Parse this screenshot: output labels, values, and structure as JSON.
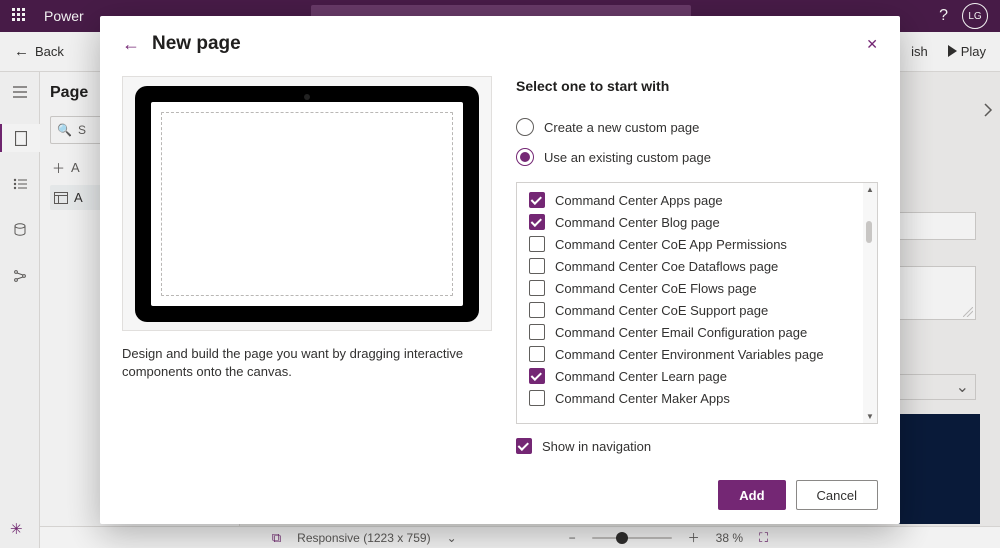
{
  "app": {
    "name": "Power",
    "user_initials": "LG"
  },
  "cmdbar": {
    "back": "Back",
    "publish_tail": "ish",
    "play": "Play"
  },
  "pages_panel": {
    "heading": "Page",
    "search_stub": "S",
    "add_stub": "A",
    "tree_stub": "A"
  },
  "statusbar": {
    "responsive": "Responsive (1223 x 759)",
    "zoom": "38 %"
  },
  "modal": {
    "title": "New page",
    "description": "Design and build the page you want by dragging interactive components onto the canvas.",
    "select_heading": "Select one to start with",
    "radios": {
      "create": {
        "label": "Create a new custom page",
        "selected": false
      },
      "use": {
        "label": "Use an existing custom page",
        "selected": true
      }
    },
    "pages": [
      {
        "label": "Command Center Apps page",
        "checked": true
      },
      {
        "label": "Command Center Blog page",
        "checked": true
      },
      {
        "label": "Command Center CoE App Permissions",
        "checked": false
      },
      {
        "label": "Command Center Coe Dataflows page",
        "checked": false
      },
      {
        "label": "Command Center CoE Flows page",
        "checked": false
      },
      {
        "label": "Command Center CoE Support page",
        "checked": false
      },
      {
        "label": "Command Center Email Configuration page",
        "checked": false
      },
      {
        "label": "Command Center Environment Variables page",
        "checked": false
      },
      {
        "label": "Command Center Learn page",
        "checked": true
      },
      {
        "label": "Command Center Maker Apps",
        "checked": false
      }
    ],
    "show_in_nav": {
      "label": "Show in navigation",
      "checked": true
    },
    "buttons": {
      "add": "Add",
      "cancel": "Cancel"
    }
  }
}
